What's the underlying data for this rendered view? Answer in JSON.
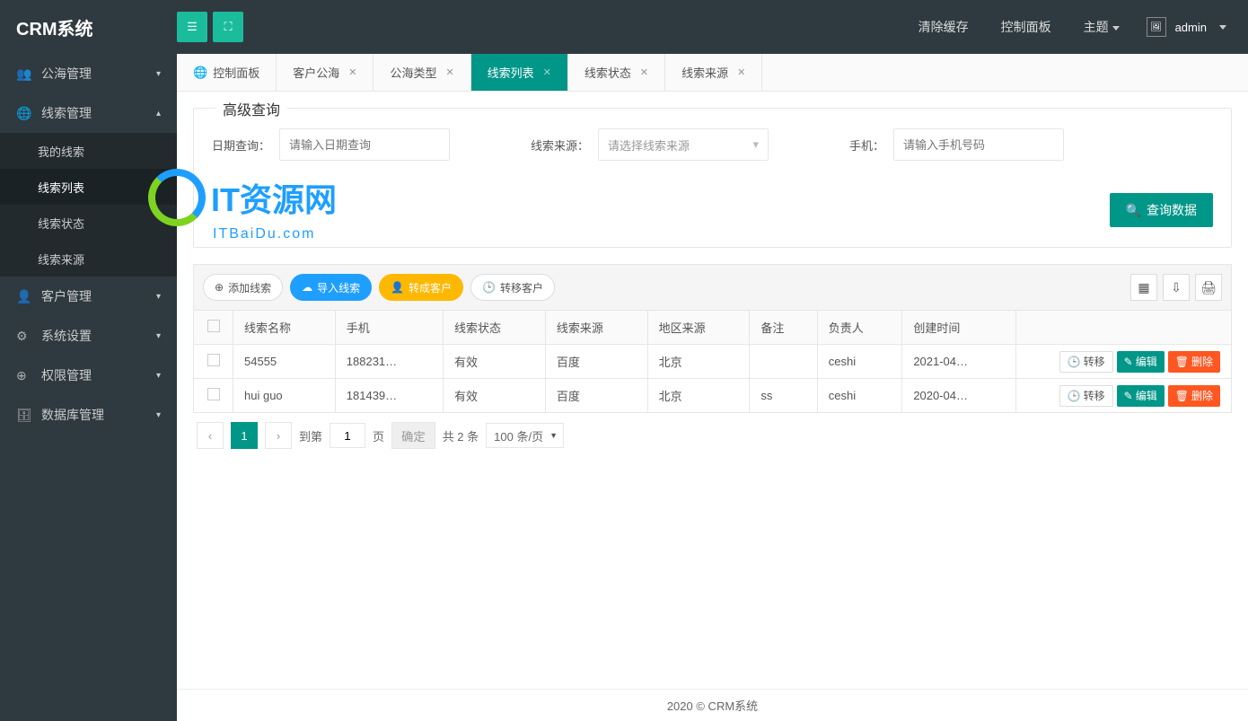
{
  "header": {
    "brand": "CRM系统",
    "links": [
      "清除缓存",
      "控制面板",
      "主题"
    ],
    "user": "admin"
  },
  "sidebar": {
    "items": [
      {
        "icon": "👥",
        "label": "公海管理",
        "expand": false
      },
      {
        "icon": "🌐",
        "label": "线索管理",
        "expand": true,
        "children": [
          "我的线索",
          "线索列表",
          "线索状态",
          "线索来源"
        ],
        "active_child": 1
      },
      {
        "icon": "👤",
        "label": "客户管理",
        "expand": false
      },
      {
        "icon": "⚙",
        "label": "系统设置",
        "expand": false
      },
      {
        "icon": "⊕",
        "label": "权限管理",
        "expand": false
      },
      {
        "icon": "🗄",
        "label": "数据库管理",
        "expand": false
      }
    ]
  },
  "tabs": [
    {
      "label": "控制面板",
      "icon": "🌐",
      "closable": false
    },
    {
      "label": "客户公海",
      "closable": true
    },
    {
      "label": "公海类型",
      "closable": true
    },
    {
      "label": "线索列表",
      "closable": true,
      "active": true
    },
    {
      "label": "线索状态",
      "closable": true
    },
    {
      "label": "线索来源",
      "closable": true
    }
  ],
  "search": {
    "legend": "高级查询",
    "date_label": "日期查询：",
    "date_placeholder": "请输入日期查询",
    "source_label": "线索来源：",
    "source_placeholder": "请选择线索来源",
    "phone_label": "手机：",
    "phone_placeholder": "请输入手机号码",
    "submit": "查询数据"
  },
  "toolbar": {
    "add": "添加线索",
    "import": "导入线索",
    "convert": "转成客户",
    "transfer": "转移客户"
  },
  "table": {
    "columns": [
      "线索名称",
      "手机",
      "线索状态",
      "线索来源",
      "地区来源",
      "备注",
      "负责人",
      "创建时间"
    ],
    "rows": [
      {
        "cells": [
          "54555",
          "188231…",
          "有效",
          "百度",
          "北京",
          "",
          "ceshi",
          "2021-04…"
        ]
      },
      {
        "cells": [
          "hui guo",
          "181439…",
          "有效",
          "百度",
          "北京",
          "ss",
          "ceshi",
          "2020-04…"
        ]
      }
    ],
    "actions": {
      "transfer": "转移",
      "edit": "编辑",
      "delete": "删除"
    }
  },
  "pager": {
    "current": "1",
    "goto_label": "到第",
    "goto_value": "1",
    "page_unit": "页",
    "confirm": "确定",
    "total": "共 2 条",
    "per_page": "100 条/页"
  },
  "footer": "2020 ©    CRM系统",
  "watermark": {
    "title": "IT资源网",
    "sub": "ITBaiDu.com"
  }
}
